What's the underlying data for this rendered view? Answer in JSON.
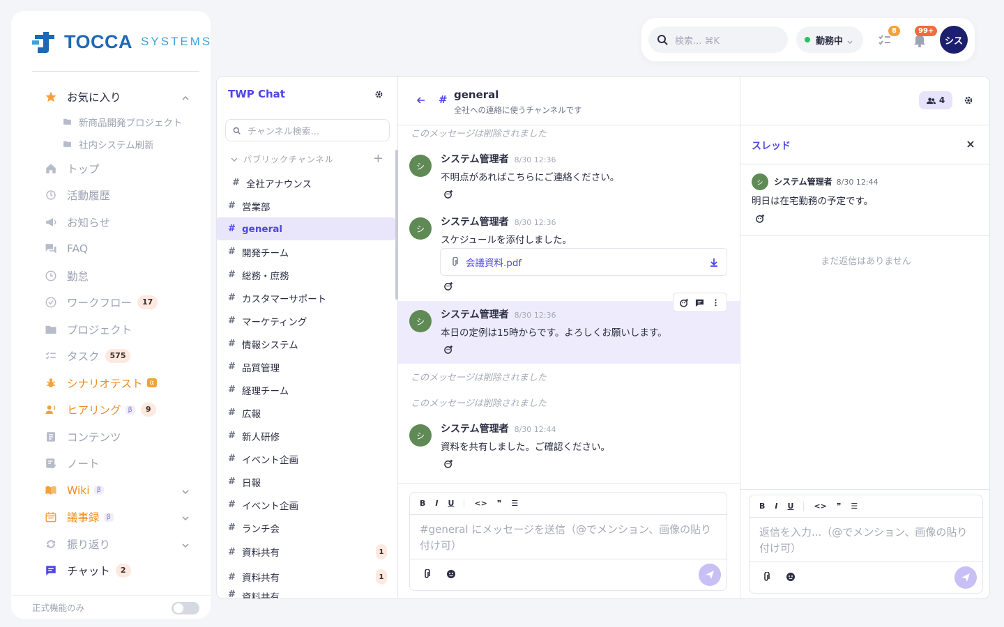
{
  "brand": {
    "name": "TOCCA",
    "suffix": "SYSTEMS"
  },
  "sidebar": {
    "items": [
      {
        "label": "お気に入り",
        "icon": "star-icon"
      },
      {
        "label": "新商品開発プロジェクト",
        "icon": "folder-icon"
      },
      {
        "label": "社内システム刷新",
        "icon": "folder-icon"
      },
      {
        "label": "トップ",
        "icon": "home-icon"
      },
      {
        "label": "活動履歴",
        "icon": "history-icon"
      },
      {
        "label": "お知らせ",
        "icon": "megaphone-icon"
      },
      {
        "label": "FAQ",
        "icon": "chat-bubbles-icon"
      },
      {
        "label": "勤怠",
        "icon": "clock-icon"
      },
      {
        "label": "ワークフロー",
        "icon": "check-circle-icon",
        "count": "17"
      },
      {
        "label": "プロジェクト",
        "icon": "folder-icon"
      },
      {
        "label": "タスク",
        "icon": "checklist-icon",
        "count": "575"
      },
      {
        "label": "シナリオテスト",
        "icon": "bug-icon",
        "tag": "α"
      },
      {
        "label": "ヒアリング",
        "icon": "interview-icon",
        "tag": "β",
        "count": "9"
      },
      {
        "label": "コンテンツ",
        "icon": "document-icon"
      },
      {
        "label": "ノート",
        "icon": "note-icon"
      },
      {
        "label": "Wiki",
        "icon": "book-icon",
        "tag": "β"
      },
      {
        "label": "議事録",
        "icon": "calendar-icon",
        "tag": "β"
      },
      {
        "label": "振り返り",
        "icon": "refresh-icon"
      },
      {
        "label": "チャット",
        "icon": "chat-icon",
        "count": "2"
      }
    ],
    "footer_label": "正式機能のみ"
  },
  "topbar": {
    "search_placeholder": "検索... ⌘K",
    "status": "勤務中",
    "task_badge": "8",
    "notify_badge": "99+",
    "avatar": "シス"
  },
  "chat": {
    "app_title": "TWP Chat",
    "channel_search_placeholder": "チャンネル検索...",
    "section_label": "パブリックチャンネル",
    "channels": [
      {
        "name": "全社アナウンス"
      },
      {
        "name": "営業部"
      },
      {
        "name": "general"
      },
      {
        "name": "開発チーム"
      },
      {
        "name": "総務・庶務"
      },
      {
        "name": "カスタマーサポート"
      },
      {
        "name": "マーケティング"
      },
      {
        "name": "情報システム"
      },
      {
        "name": "品質管理"
      },
      {
        "name": "経理チーム"
      },
      {
        "name": "広報"
      },
      {
        "name": "新人研修"
      },
      {
        "name": "イベント企画"
      },
      {
        "name": "日報"
      },
      {
        "name": "イベント企画"
      },
      {
        "name": "ランチ会"
      },
      {
        "name": "資料共有",
        "unread": "1"
      },
      {
        "name": "資料共有",
        "unread": "1"
      },
      {
        "name": "資料共有"
      }
    ]
  },
  "conversation": {
    "channel_name": "general",
    "channel_desc": "全社への連絡に使うチャンネルです",
    "member_count": "4",
    "deleted_text": "このメッセージは削除されました",
    "messages": [
      {
        "author": "システム管理者",
        "time": "8/30 12:36",
        "text": "不明点があればこちらにご連絡ください。",
        "avatar": "シ"
      },
      {
        "author": "システム管理者",
        "time": "8/30 12:36",
        "text": "スケジュールを添付しました。",
        "avatar": "シ",
        "file": "会議資料.pdf"
      },
      {
        "author": "システム管理者",
        "time": "8/30 12:36",
        "text": "本日の定例は15時からです。よろしくお願いします。",
        "avatar": "シ"
      },
      {
        "author": "システム管理者",
        "time": "8/30 12:44",
        "text": "資料を共有しました。ご確認ください。",
        "avatar": "シ"
      }
    ],
    "composer_placeholder": "#general にメッセージを送信（@でメンション、画像の貼り付け可）",
    "format_buttons": [
      "B",
      "I",
      "U",
      "<>",
      "❞",
      "☰"
    ]
  },
  "thread": {
    "title": "スレッド",
    "message": {
      "author": "システム管理者",
      "time": "8/30 12:44",
      "text": "明日は在宅勤務の予定です。",
      "avatar": "シ"
    },
    "empty_text": "まだ返信はありません",
    "composer_placeholder": "返信を入力...（@でメンション、画像の貼り付け可）"
  },
  "colors": {
    "accent": "#4f46e5",
    "brand": "#1f68b5",
    "orange": "#f08c1e",
    "avatar_green": "#5f8a55",
    "hover": "#eeebfc"
  }
}
